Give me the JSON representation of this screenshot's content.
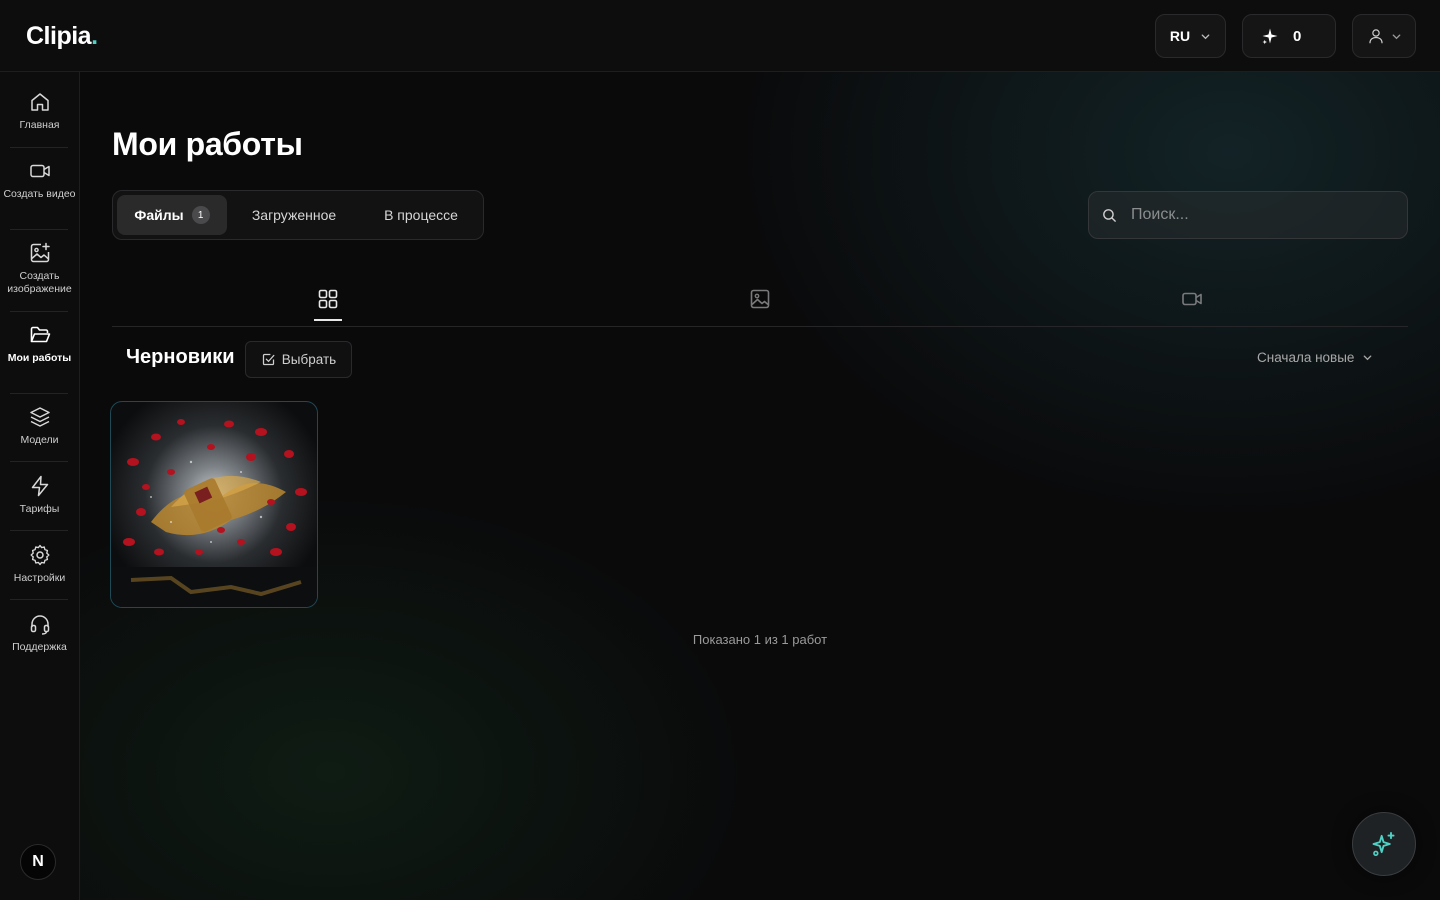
{
  "app": {
    "logo_text": "Clipia",
    "logo_dot": "."
  },
  "topbar": {
    "language": "RU",
    "credits": "0"
  },
  "sidebar": {
    "items": [
      {
        "label": "Главная",
        "icon": "home-icon"
      },
      {
        "label": "Создать видео",
        "icon": "video-icon"
      },
      {
        "label": "Создать изображение",
        "icon": "image-plus-icon"
      },
      {
        "label": "Мои работы",
        "icon": "folder-icon"
      },
      {
        "label": "Модели",
        "icon": "layers-icon"
      },
      {
        "label": "Тарифы",
        "icon": "lightning-icon"
      },
      {
        "label": "Настройки",
        "icon": "gear-icon"
      },
      {
        "label": "Поддержка",
        "icon": "headphones-icon"
      }
    ],
    "active_index": 3,
    "footer_badge": "N"
  },
  "main": {
    "title": "Мои работы",
    "tabs": [
      {
        "label": "Файлы",
        "count": "1",
        "active": true
      },
      {
        "label": "Загруженное",
        "active": false
      },
      {
        "label": "В процессе",
        "active": false
      }
    ],
    "search": {
      "placeholder": "Поиск..."
    },
    "type_filters": [
      {
        "icon": "grid-icon",
        "active": true
      },
      {
        "icon": "image-icon",
        "active": false
      },
      {
        "icon": "video-icon",
        "active": false
      }
    ],
    "section": {
      "title": "Черновики",
      "select_label": "Выбрать",
      "sort_label": "Сначала новые"
    },
    "showing_text": "Показано 1 из 1 работ"
  },
  "colors": {
    "accent": "#4fd1c5",
    "background": "#0a0a0b",
    "card_border": "#1f4a55"
  }
}
